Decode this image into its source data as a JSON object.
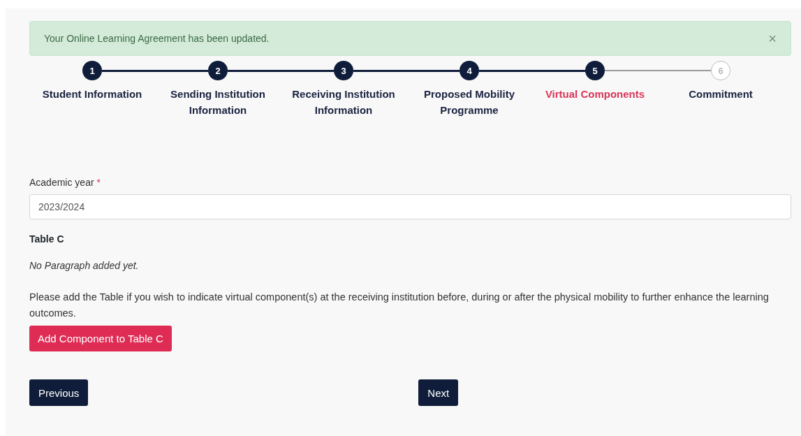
{
  "alert": {
    "message": "Your Online Learning Agreement has been updated.",
    "close": "×"
  },
  "steps": [
    {
      "number": "1",
      "label": "Student Information",
      "reached": true,
      "selected": false
    },
    {
      "number": "2",
      "label": "Sending Institution Information",
      "reached": true,
      "selected": false
    },
    {
      "number": "3",
      "label": "Receiving Institution Information",
      "reached": true,
      "selected": false
    },
    {
      "number": "4",
      "label": "Proposed Mobility Programme",
      "reached": true,
      "selected": false
    },
    {
      "number": "5",
      "label": "Virtual Components",
      "reached": true,
      "selected": true
    },
    {
      "number": "6",
      "label": "Commitment",
      "reached": false,
      "selected": false
    }
  ],
  "academic_year": {
    "label": "Academic year",
    "required_mark": "*",
    "value": "2023/2024"
  },
  "table_c": {
    "heading": "Table C",
    "empty_note": "No Paragraph added yet.",
    "help": "Please add the Table if you wish to indicate virtual component(s) at the receiving institution before, during or after the physical mobility to further enhance the learning outcomes.",
    "add_button": "Add Component to Table C"
  },
  "buttons": {
    "previous": "Previous",
    "next": "Next"
  }
}
